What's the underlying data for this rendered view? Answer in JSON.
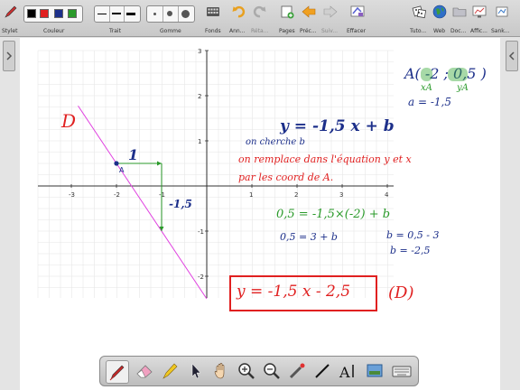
{
  "toolbar": {
    "stylet": "Stylet",
    "couleur": "Couleur",
    "trait": "Trait",
    "gomme": "Gomme",
    "fonds": "Fonds",
    "annuler": "Ann...",
    "refaire": "Réta...",
    "pages": "Pages",
    "precedent": "Préc...",
    "suivant": "Suiv...",
    "effacer": "Effacer",
    "tutoriel": "Tuto...",
    "web": "Web",
    "documents": "Doc...",
    "affichage": "Affic...",
    "sankore": "Sank...",
    "colors": [
      "#000000",
      "#e02020",
      "#1c2f8a",
      "#2a9a2a"
    ]
  },
  "graph": {
    "x_ticks": [
      "-3",
      "-2",
      "-1",
      "1",
      "2",
      "3",
      "4"
    ],
    "y_ticks": [
      "3",
      "2",
      "1",
      "-1",
      "-2"
    ],
    "point_label": "A",
    "curve_label": "D",
    "run_label": "1",
    "rise_label": "-1,5",
    "line_color": "#e040e0",
    "point_color": "#1c2f8a"
  },
  "notes": {
    "equation": "y = -1,5 x + b",
    "cherche": "on cherche b",
    "remplace1": "on remplace dans l'équation y et x",
    "remplace2": "par les coord de A.",
    "coords_A": "A( -2 ; 0,5 )",
    "xa": "xA",
    "ya": "yA",
    "a_value": "a = -1,5",
    "sub1": "0,5 = -1,5×(-2) + b",
    "sub2": "0,5 = 3 + b",
    "b1": "b = 0,5 - 3",
    "b2": "b = -2,5",
    "final_eq": "y = -1,5 x - 2,5",
    "final_label": "(D)"
  }
}
